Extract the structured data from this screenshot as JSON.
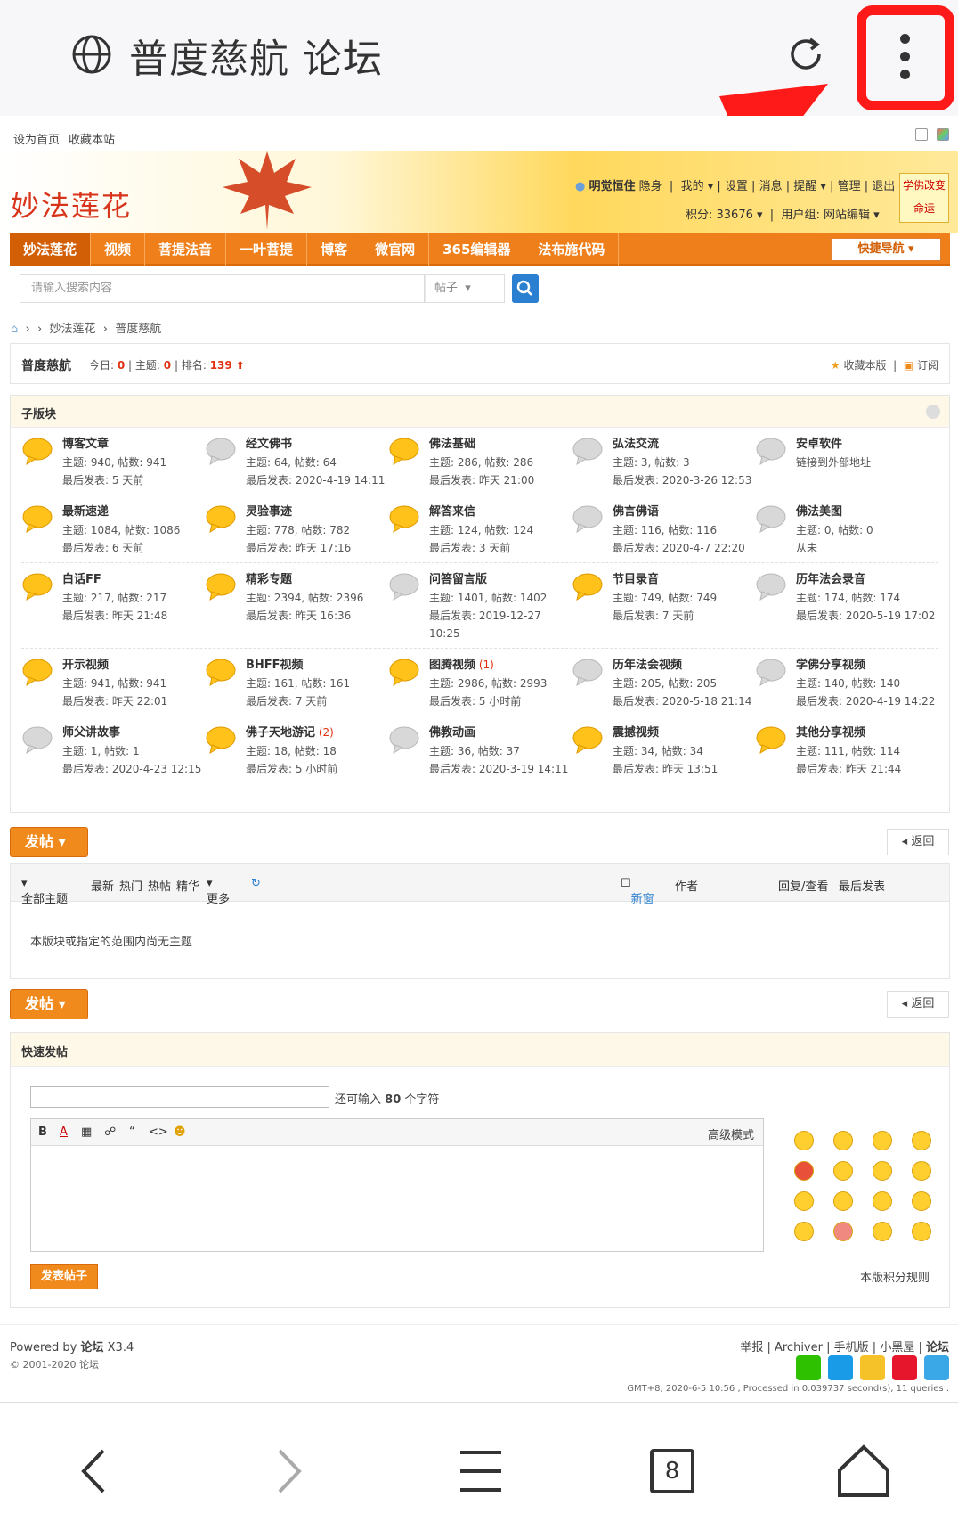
{
  "browser": {
    "title": "普度慈航 论坛"
  },
  "subtop": {
    "set_home": "设为首页",
    "bookmark": "收藏本站"
  },
  "header": {
    "logo": "妙法莲花",
    "user_name": "明觉恒住",
    "invisible": "隐身",
    "menu": [
      "我的",
      "设置",
      "消息",
      "提醒",
      "管理",
      "退出"
    ],
    "points": "积分: 33676",
    "group": "用户组: 网站编辑",
    "badge": "学佛改变命运"
  },
  "nav": {
    "items": [
      "妙法莲花",
      "视频",
      "菩提法音",
      "一叶菩提",
      "博客",
      "微官网",
      "365编辑器",
      "法布施代码"
    ],
    "quick": "快捷导航"
  },
  "search": {
    "placeholder": "请输入搜索内容",
    "type": "帖子"
  },
  "breadcrumb": {
    "home_sep": "›",
    "path1": "妙法莲花",
    "path2": "普度慈航"
  },
  "forum": {
    "name": "普度慈航",
    "today_label": "今日:",
    "today": "0",
    "topics_label": "主题:",
    "topics": "0",
    "rank_label": "排名:",
    "rank": "139",
    "fav": "收藏本版",
    "subscribe": "订阅"
  },
  "subforums": {
    "title": "子版块",
    "rows": [
      [
        {
          "name": "博客文章",
          "l2": "主题: 940, 帖数: 941",
          "l3": "最后发表: 5 天前",
          "new": ""
        },
        {
          "name": "经文佛书",
          "l2": "主题: 64, 帖数: 64",
          "l3": "最后发表: 2020-4-19 14:11",
          "new": ""
        },
        {
          "name": "佛法基础",
          "l2": "主题: 286, 帖数: 286",
          "l3": "最后发表: 昨天 21:00",
          "new": ""
        },
        {
          "name": "弘法交流",
          "l2": "主题: 3, 帖数: 3",
          "l3": "最后发表: 2020-3-26 12:53",
          "new": ""
        },
        {
          "name": "安卓软件",
          "l2": "链接到外部地址",
          "l3": "",
          "new": ""
        }
      ],
      [
        {
          "name": "最新速递",
          "l2": "主题: 1084, 帖数: 1086",
          "l3": "最后发表: 6 天前",
          "new": ""
        },
        {
          "name": "灵验事迹",
          "l2": "主题: 778, 帖数: 782",
          "l3": "最后发表: 昨天 17:16",
          "new": ""
        },
        {
          "name": "解答来信",
          "l2": "主题: 124, 帖数: 124",
          "l3": "最后发表: 3 天前",
          "new": ""
        },
        {
          "name": "佛言佛语",
          "l2": "主题: 116, 帖数: 116",
          "l3": "最后发表: 2020-4-7 22:20",
          "new": ""
        },
        {
          "name": "佛法美图",
          "l2": "主题: 0, 帖数: 0",
          "l3": "从未",
          "new": ""
        }
      ],
      [
        {
          "name": "白话FF",
          "l2": "主题: 217, 帖数: 217",
          "l3": "最后发表: 昨天 21:48",
          "new": ""
        },
        {
          "name": "精彩专题",
          "l2": "主题: 2394, 帖数: 2396",
          "l3": "最后发表: 昨天 16:36",
          "new": ""
        },
        {
          "name": "问答留言版",
          "l2": "主题: 1401, 帖数: 1402",
          "l3": "最后发表: 2019-12-27",
          "l4": "10:25",
          "new": ""
        },
        {
          "name": "节目录音",
          "l2": "主题: 749, 帖数: 749",
          "l3": "最后发表: 7 天前",
          "new": ""
        },
        {
          "name": "历年法会录音",
          "l2": "主题: 174, 帖数: 174",
          "l3": "最后发表: 2020-5-19 17:02",
          "new": ""
        }
      ],
      [
        {
          "name": "开示视频",
          "l2": "主题: 941, 帖数: 941",
          "l3": "最后发表: 昨天 22:01",
          "new": ""
        },
        {
          "name": "BHFF视频",
          "l2": "主题: 161, 帖数: 161",
          "l3": "最后发表: 7 天前",
          "new": ""
        },
        {
          "name": "图腾视频",
          "l2": "主题: 2986, 帖数: 2993",
          "l3": "最后发表: 5 小时前",
          "new": "(1)"
        },
        {
          "name": "历年法会视频",
          "l2": "主题: 205, 帖数: 205",
          "l3": "最后发表: 2020-5-18 21:14",
          "new": ""
        },
        {
          "name": "学佛分享视频",
          "l2": "主题: 140, 帖数: 140",
          "l3": "最后发表: 2020-4-19 14:22",
          "new": ""
        }
      ],
      [
        {
          "name": "师父讲故事",
          "l2": "主题: 1, 帖数: 1",
          "l3": "最后发表: 2020-4-23 12:15",
          "new": ""
        },
        {
          "name": "佛子天地游记",
          "l2": "主题: 18, 帖数: 18",
          "l3": "最后发表: 5 小时前",
          "new": "(2)"
        },
        {
          "name": "佛教动画",
          "l2": "主题: 36, 帖数: 37",
          "l3": "最后发表: 2020-3-19 14:11",
          "new": ""
        },
        {
          "name": "震撼视频",
          "l2": "主题: 34, 帖数: 34",
          "l3": "最后发表: 昨天 13:51",
          "new": ""
        },
        {
          "name": "其他分享视频",
          "l2": "主题: 111, 帖数: 114",
          "l3": "最后发表: 昨天 21:44",
          "new": ""
        }
      ]
    ]
  },
  "actions": {
    "post": "发帖",
    "back": "返回"
  },
  "topics": {
    "filters": [
      "全部主题",
      "最新",
      "热门",
      "热帖",
      "精华",
      "更多"
    ],
    "new_window": "新窗",
    "author": "作者",
    "replies": "回复/查看",
    "last": "最后发表",
    "empty": "本版块或指定的范围内尚无主题"
  },
  "quick_post": {
    "title": "快速发帖",
    "count_prefix": "还可输入",
    "count": "80",
    "count_suffix": "个字符",
    "advanced": "高级模式",
    "submit": "发表帖子",
    "rules": "本版积分规则"
  },
  "footer": {
    "powered_prefix": "Powered by",
    "powered_name": "论坛",
    "powered_ver": "X3.4",
    "copyright": "© 2001-2020 论坛",
    "links": [
      "举报",
      "Archiver",
      "手机版",
      "小黑屋",
      "论坛"
    ],
    "gmt": "GMT+8, 2020-6-5 10:56 , Processed in 0.039737 second(s), 11 queries ."
  },
  "bottom_bar": {
    "tabs_count": "8"
  },
  "colors": {
    "nav": "#ef7f1a",
    "accent_red": "#ff1a1a",
    "new_red": "#e03010"
  }
}
